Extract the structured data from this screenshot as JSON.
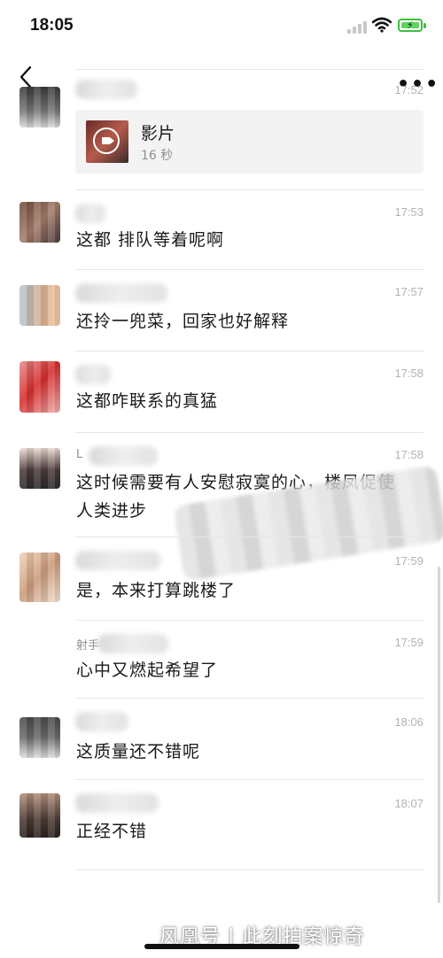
{
  "status": {
    "time": "18:05"
  },
  "video": {
    "title": "影片",
    "duration": "16 秒"
  },
  "messages": [
    {
      "time": "17:52"
    },
    {
      "time": "17:53",
      "text": "这都 排队等着呢啊"
    },
    {
      "time": "17:57",
      "text": "还拎一兜菜，回家也好解释"
    },
    {
      "time": "17:58",
      "text": "这都咋联系的真猛"
    },
    {
      "time": "17:58",
      "name": "L",
      "line1": "这时候需要有人安慰寂寞的心，楼凤促使",
      "line2": "人类进步"
    },
    {
      "time": "17:59",
      "text": "是，本来打算跳楼了"
    },
    {
      "time": "17:59",
      "name": "射手",
      "text": "心中又燃起希望了"
    },
    {
      "time": "18:06",
      "text": "这质量还不错呢"
    },
    {
      "time": "18:07",
      "text": "正经不错"
    }
  ],
  "watermark": "风凰号 | 此刻拍案惊奇",
  "colors": {
    "accent_green": "#5fd45f",
    "text": "#191919",
    "muted": "#b2b2b2"
  }
}
